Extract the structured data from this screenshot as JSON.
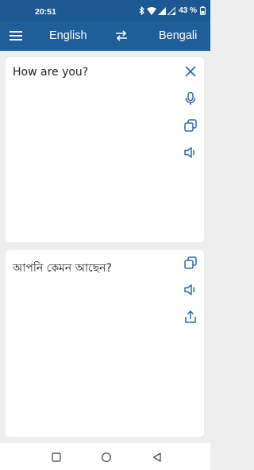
{
  "status_bar": {
    "time": "20:51",
    "battery": "43 %",
    "icons": [
      "bluetooth-icon",
      "wifi-icon",
      "signal-icon",
      "signal-icon",
      "battery-icon"
    ]
  },
  "app_bar": {
    "menu_icon": "menu-icon",
    "source_language": "English",
    "swap_icon": "swap-icon",
    "target_language": "Bengali"
  },
  "input_card": {
    "text": "How are you?",
    "actions": [
      "close-icon",
      "microphone-icon",
      "copy-icon",
      "speaker-icon"
    ]
  },
  "output_card": {
    "text": "আপনি কেমন আছেন?",
    "actions": [
      "copy-icon",
      "speaker-icon",
      "share-icon"
    ]
  },
  "nav_bar": {
    "buttons": [
      "recents-icon",
      "home-icon",
      "back-icon"
    ]
  },
  "colors": {
    "primary": "#1f5e98",
    "icon_blue": "#2a6aa7",
    "background": "#eeeeee"
  }
}
